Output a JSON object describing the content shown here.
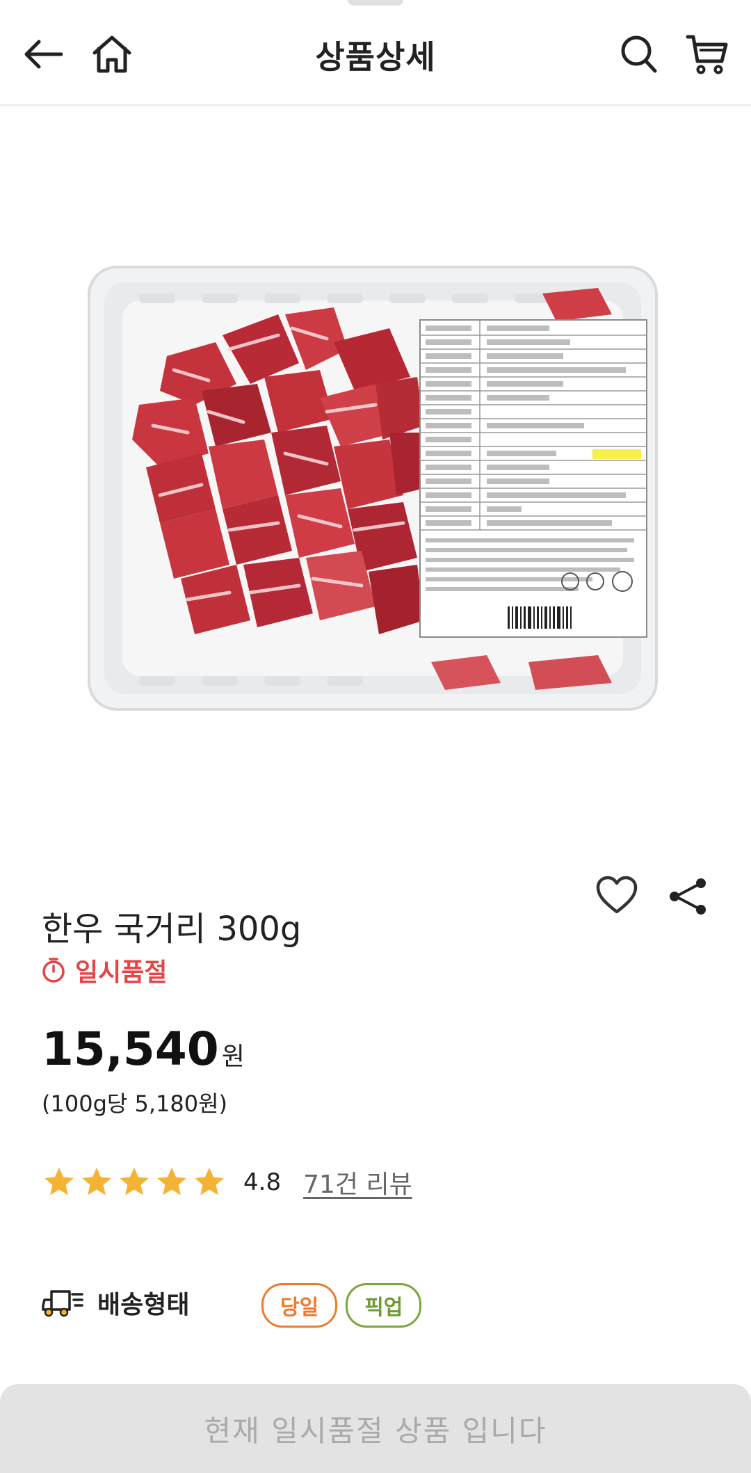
{
  "header": {
    "title": "상품상세",
    "icons": [
      "back-arrow-icon",
      "home-icon",
      "search-icon",
      "cart-icon"
    ]
  },
  "product": {
    "image_alt": "한우 국거리 300g 포장 제품 사진",
    "name": "한우 국거리 300g",
    "stock_status": "일시품절",
    "price": "15,540",
    "currency": "원",
    "unit_price": "(100g당 5,180원)",
    "rating": {
      "stars": 5,
      "score": "4.8",
      "review_count_label": "71건 리뷰"
    },
    "actions": [
      "heart-icon",
      "share-icon"
    ]
  },
  "delivery": {
    "label": "배송형태",
    "badges": [
      {
        "label": "당일",
        "color": "#ef7a2b"
      },
      {
        "label": "픽업",
        "color": "#7aa63a"
      }
    ]
  },
  "bottom_bar": {
    "text": "현재 일시품절 상품 입니다"
  },
  "colors": {
    "sold_out": "#e44545",
    "star": "#f5b335",
    "disabled_bg": "#e3e3e3"
  }
}
